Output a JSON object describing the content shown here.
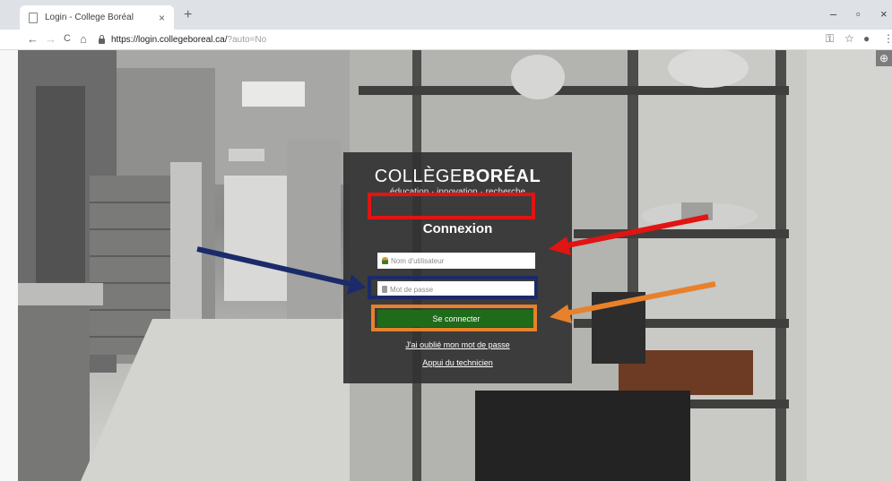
{
  "browser": {
    "tab_title": "Login - College Boréal",
    "tab_close": "×",
    "new_tab": "+",
    "url_main": "https://login.collegeboreal.ca/",
    "url_rest": "?auto=No",
    "window_controls": {
      "minimize": "–",
      "maximize": "▫",
      "close": "×"
    },
    "nav": {
      "back": "←",
      "forward": "→",
      "reload": "C",
      "home": "⌂"
    },
    "toolbar_icons": {
      "key": "⚿",
      "star": "☆",
      "profile": "●",
      "menu": "⋮"
    }
  },
  "page": {
    "globe_button": "⊕",
    "logo": {
      "college_light": "COLLÈGE",
      "college_bold": "BORÉAL",
      "tagline": "éducation · innovation · recherche"
    },
    "heading": "Connexion",
    "username_placeholder": "Nom d'utilisateur",
    "password_placeholder": "Mot de passe",
    "submit_label": "Se connecter",
    "forgot_link": "J'ai oublié mon mot de passe",
    "help_link": "Appui du technicien"
  },
  "annotations": {
    "colors": {
      "red": "#e11414",
      "navy": "#1b2a6a",
      "orange": "#e7812c"
    }
  }
}
